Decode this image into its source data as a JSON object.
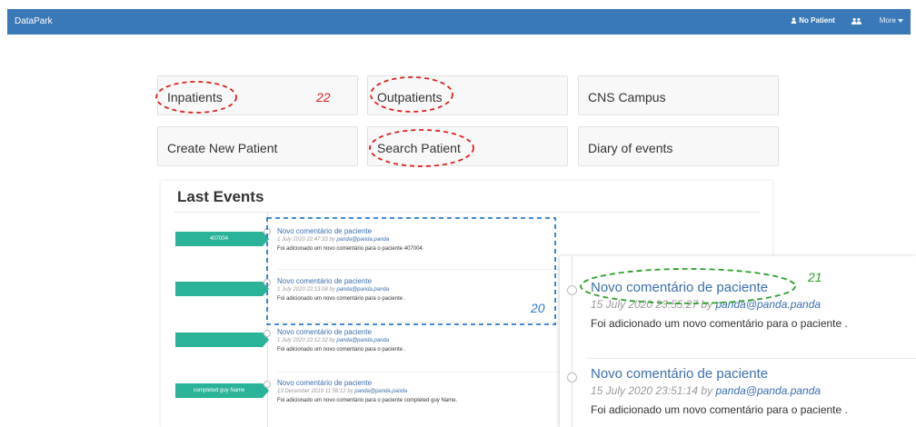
{
  "navbar": {
    "brand": "DataPark",
    "patient_label": "No Patient",
    "more_label": "More",
    "color": "#3a79b7"
  },
  "tiles": [
    {
      "label": "Inpatients"
    },
    {
      "label": "Outpatients"
    },
    {
      "label": "CNS Campus"
    },
    {
      "label": "Create New Patient"
    },
    {
      "label": "Search Patient"
    },
    {
      "label": "Diary of events"
    }
  ],
  "last_events": {
    "title": "Last Events",
    "events": [
      {
        "tag": "407004",
        "title": "Novo comentário de paciente",
        "date": "1 July 2020 22:47:33 by",
        "user": "panda@panda.panda",
        "desc": "Foi adicionado um novo comentário para o paciente 407004."
      },
      {
        "tag": "",
        "title": "Novo comentário de paciente",
        "date": "1 July 2020 22:13:08 by",
        "user": "panda@panda.panda",
        "desc": "Foi adicionado um novo comentário para o paciente ."
      },
      {
        "tag": "",
        "title": "Novo comentário de paciente",
        "date": "1 July 2020 22:12:32 by",
        "user": "panda@panda.panda",
        "desc": "Foi adicionado um novo comentário para o paciente ."
      },
      {
        "tag": "completed guy Name",
        "title": "Novo comentário de paciente",
        "date": "13 December 2019 11:56:12 by",
        "user": "panda@panda.panda",
        "desc": "Foi adicionado um novo comentário para o paciente completed guy Name."
      }
    ],
    "tag_color": "#2ab398"
  },
  "zoomed_events": [
    {
      "title": "Novo comentário de paciente",
      "date": "15 July 2020 23:55:27 by",
      "user": "panda@panda.panda",
      "desc": "Foi adicionado um novo comentário para o paciente ."
    },
    {
      "title": "Novo comentário de paciente",
      "date": "15 July 2020 23:51:14 by",
      "user": "panda@panda.panda",
      "desc": "Foi adicionado um novo comentário para o paciente ."
    }
  ],
  "annotations": {
    "a20": "20",
    "a21": "21",
    "a22": "22",
    "red": "#e02020",
    "blue": "#2a78c8",
    "green": "#2aa02a"
  }
}
